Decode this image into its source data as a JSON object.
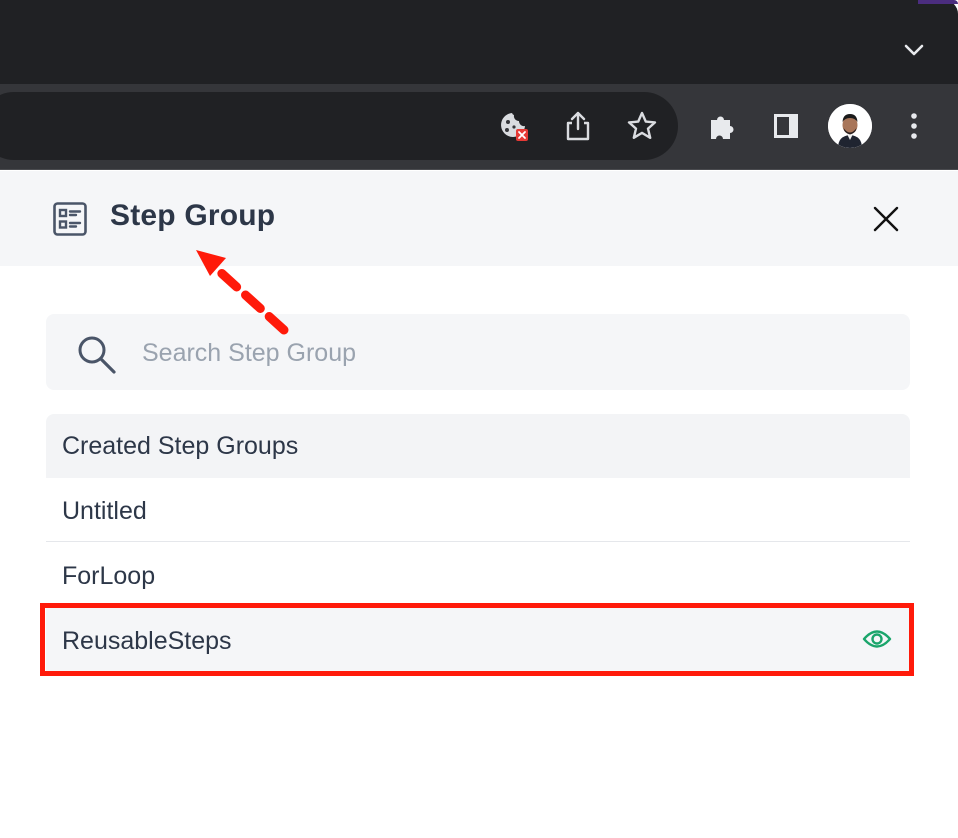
{
  "browser": {
    "toolbar_icons": [
      "cookie-blocked-icon",
      "share-icon",
      "bookmark-star-icon",
      "extensions-puzzle-icon",
      "side-panel-icon",
      "avatar",
      "more-vert-icon"
    ],
    "tab_menu_icon": "chevron-down-icon"
  },
  "panel": {
    "title": "Step Group",
    "header_icon": "list-details-icon",
    "close_icon": "close-icon"
  },
  "search": {
    "placeholder": "Search Step Group",
    "value": ""
  },
  "list": {
    "header": "Created Step Groups",
    "items": [
      {
        "label": "Untitled",
        "selected": false
      },
      {
        "label": "ForLoop",
        "selected": false
      },
      {
        "label": "ReusableSteps",
        "selected": true,
        "action_icon": "eye-icon"
      }
    ]
  },
  "colors": {
    "accent_green": "#1aa56b",
    "annotation_red": "#ff1a0a",
    "title_text": "#2d3748"
  }
}
